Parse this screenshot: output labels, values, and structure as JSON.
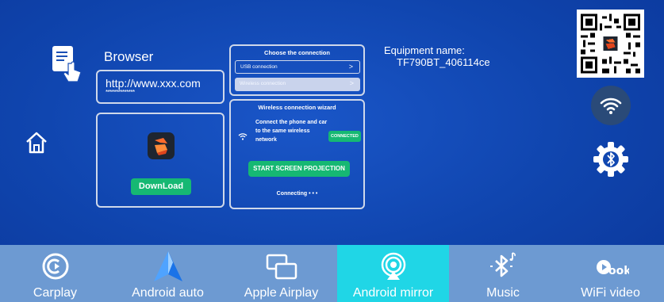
{
  "browser": {
    "title": "Browser",
    "url": "http://www.xxx.com",
    "url_mask": "**************",
    "download_label": "DownLoad"
  },
  "choose": {
    "title": "Choose the connection",
    "usb_label": "USB connection",
    "wireless_label": "Wireless connection",
    "chevron": ">"
  },
  "wizard": {
    "title": "Wireless connection wizard",
    "instruction": "Connect the phone and car to the same wireless network",
    "status_badge": "CONNECTED",
    "projection_label": "START SCREEN PROJECTION",
    "connecting": "Connecting • • •"
  },
  "equipment": {
    "label": "Equipment name:",
    "value": "TF790BT_406114ce"
  },
  "nav": {
    "items": [
      {
        "label": "Carplay",
        "icon": "carplay-icon"
      },
      {
        "label": "Android auto",
        "icon": "android-auto-icon"
      },
      {
        "label": "Apple Airplay",
        "icon": "airplay-icon"
      },
      {
        "label": "Android mirror",
        "icon": "android-mirror-icon",
        "active": true
      },
      {
        "label": "Music",
        "icon": "bluetooth-music-icon"
      },
      {
        "label": "WiFi video",
        "icon": "wifi-video-icon"
      }
    ]
  },
  "colors": {
    "background": "#1047b0",
    "accent_green": "#16b873",
    "nav_bar": "#6d9ad2",
    "nav_active": "#20d6e6"
  }
}
